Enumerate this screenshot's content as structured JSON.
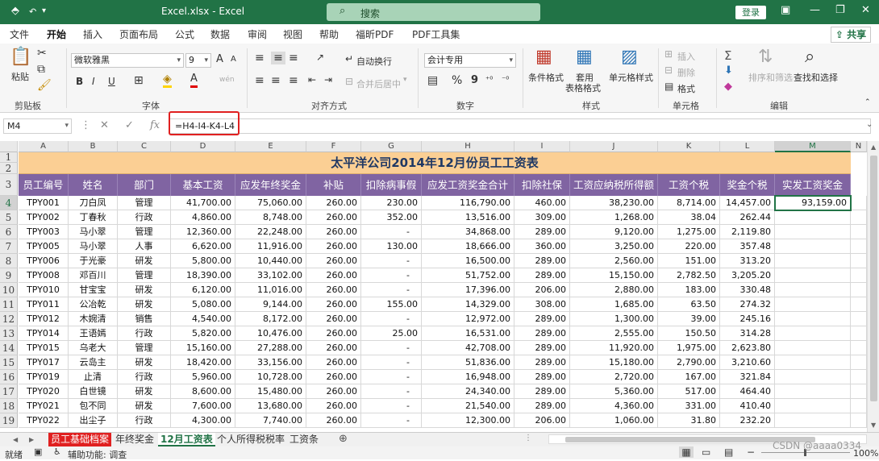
{
  "window": {
    "title": "Excel.xlsx  -  Excel",
    "search_placeholder": "搜索",
    "login": "登录",
    "share": "共享"
  },
  "ribbon_tabs": [
    "文件",
    "开始",
    "插入",
    "页面布局",
    "公式",
    "数据",
    "审阅",
    "视图",
    "帮助",
    "福昕PDF",
    "PDF工具集"
  ],
  "ribbon": {
    "clipboard": {
      "label": "剪贴板",
      "paste": "粘贴"
    },
    "font": {
      "label": "字体",
      "font_name": "微软雅黑",
      "font_size": "9",
      "bold": "B",
      "italic": "I",
      "underline": "U",
      "grow": "A",
      "shrink": "A",
      "font_color": "A",
      "wen": "wén"
    },
    "alignment": {
      "label": "对齐方式",
      "wrap": "自动换行",
      "merge": "合并后居中"
    },
    "number": {
      "label": "数字",
      "format": "会计专用",
      "percent": "%",
      "comma": "9"
    },
    "styles": {
      "label": "样式",
      "conditional": "条件格式",
      "table": "套用",
      "table2": "表格格式",
      "cell_styles": "单元格样式"
    },
    "cells": {
      "label": "单元格",
      "insert": "插入",
      "delete": "删除",
      "format": "格式"
    },
    "editing": {
      "label": "编辑",
      "sort": "排序和筛选",
      "find": "查找和选择",
      "sigma": "Σ"
    }
  },
  "formula_bar": {
    "name_box": "M4",
    "formula": "=H4-I4-K4-L4",
    "fx": "fx"
  },
  "columns": [
    "A",
    "B",
    "C",
    "D",
    "E",
    "F",
    "G",
    "H",
    "I",
    "J",
    "K",
    "L",
    "M",
    "N"
  ],
  "row_numbers": [
    "1",
    "2",
    "3",
    "4",
    "5",
    "6",
    "7",
    "8",
    "9",
    "10",
    "11",
    "12",
    "13",
    "14",
    "15",
    "16",
    "17",
    "18",
    "19"
  ],
  "sheet_title": "太平洋公司2014年12月份员工工资表",
  "headers": [
    "员工编号",
    "姓名",
    "部门",
    "基本工资",
    "应发年终奖金",
    "补贴",
    "扣除病事假",
    "应发工资奖金合计",
    "扣除社保",
    "工资应纳税所得额",
    "工资个税",
    "奖金个税",
    "实发工资奖金"
  ],
  "rows": [
    [
      "TPY001",
      "刀白凤",
      "管理",
      "41,700.00",
      "75,060.00",
      "260.00",
      "230.00",
      "116,790.00",
      "460.00",
      "38,230.00",
      "8,714.00",
      "14,457.00",
      "93,159.00"
    ],
    [
      "TPY002",
      "丁春秋",
      "行政",
      "4,860.00",
      "8,748.00",
      "260.00",
      "352.00",
      "13,516.00",
      "309.00",
      "1,268.00",
      "38.04",
      "262.44",
      ""
    ],
    [
      "TPY003",
      "马小翠",
      "管理",
      "12,360.00",
      "22,248.00",
      "260.00",
      "-",
      "34,868.00",
      "289.00",
      "9,120.00",
      "1,275.00",
      "2,119.80",
      ""
    ],
    [
      "TPY005",
      "马小翠",
      "人事",
      "6,620.00",
      "11,916.00",
      "260.00",
      "130.00",
      "18,666.00",
      "360.00",
      "3,250.00",
      "220.00",
      "357.48",
      ""
    ],
    [
      "TPY006",
      "于光豪",
      "研发",
      "5,800.00",
      "10,440.00",
      "260.00",
      "-",
      "16,500.00",
      "289.00",
      "2,560.00",
      "151.00",
      "313.20",
      ""
    ],
    [
      "TPY008",
      "邓百川",
      "管理",
      "18,390.00",
      "33,102.00",
      "260.00",
      "-",
      "51,752.00",
      "289.00",
      "15,150.00",
      "2,782.50",
      "3,205.20",
      ""
    ],
    [
      "TPY010",
      "甘宝宝",
      "研发",
      "6,120.00",
      "11,016.00",
      "260.00",
      "-",
      "17,396.00",
      "206.00",
      "2,880.00",
      "183.00",
      "330.48",
      ""
    ],
    [
      "TPY011",
      "公冶乾",
      "研发",
      "5,080.00",
      "9,144.00",
      "260.00",
      "155.00",
      "14,329.00",
      "308.00",
      "1,685.00",
      "63.50",
      "274.32",
      ""
    ],
    [
      "TPY012",
      "木婉清",
      "销售",
      "4,540.00",
      "8,172.00",
      "260.00",
      "-",
      "12,972.00",
      "289.00",
      "1,300.00",
      "39.00",
      "245.16",
      ""
    ],
    [
      "TPY014",
      "王语嫣",
      "行政",
      "5,820.00",
      "10,476.00",
      "260.00",
      "25.00",
      "16,531.00",
      "289.00",
      "2,555.00",
      "150.50",
      "314.28",
      ""
    ],
    [
      "TPY015",
      "乌老大",
      "管理",
      "15,160.00",
      "27,288.00",
      "260.00",
      "-",
      "42,708.00",
      "289.00",
      "11,920.00",
      "1,975.00",
      "2,623.80",
      ""
    ],
    [
      "TPY017",
      "云岛主",
      "研发",
      "18,420.00",
      "33,156.00",
      "260.00",
      "-",
      "51,836.00",
      "289.00",
      "15,180.00",
      "2,790.00",
      "3,210.60",
      ""
    ],
    [
      "TPY019",
      "止清",
      "行政",
      "5,960.00",
      "10,728.00",
      "260.00",
      "-",
      "16,948.00",
      "289.00",
      "2,720.00",
      "167.00",
      "321.84",
      ""
    ],
    [
      "TPY020",
      "白世镜",
      "研发",
      "8,600.00",
      "15,480.00",
      "260.00",
      "-",
      "24,340.00",
      "289.00",
      "5,360.00",
      "517.00",
      "464.40",
      ""
    ],
    [
      "TPY021",
      "包不同",
      "研发",
      "7,600.00",
      "13,680.00",
      "260.00",
      "-",
      "21,540.00",
      "289.00",
      "4,360.00",
      "331.00",
      "410.40",
      ""
    ],
    [
      "TPY022",
      "出尘子",
      "行政",
      "4,300.00",
      "7,740.00",
      "260.00",
      "-",
      "12,300.00",
      "206.00",
      "1,060.00",
      "31.80",
      "232.20",
      ""
    ]
  ],
  "sheet_tabs": [
    "员工基础档案",
    "年终奖金",
    "12月工资表",
    "个人所得税税率",
    "工资条"
  ],
  "active_sheet_tab": "12月工资表",
  "status": {
    "ready": "就绪",
    "accessibility": "辅助功能: 调查",
    "zoom": "100%"
  },
  "watermark": "CSDN @aaaa0334",
  "colors": {
    "excel_green": "#217346",
    "title_fill": "#fbcf94",
    "header_fill": "#8064a2",
    "highlight_red": "#e02020"
  }
}
